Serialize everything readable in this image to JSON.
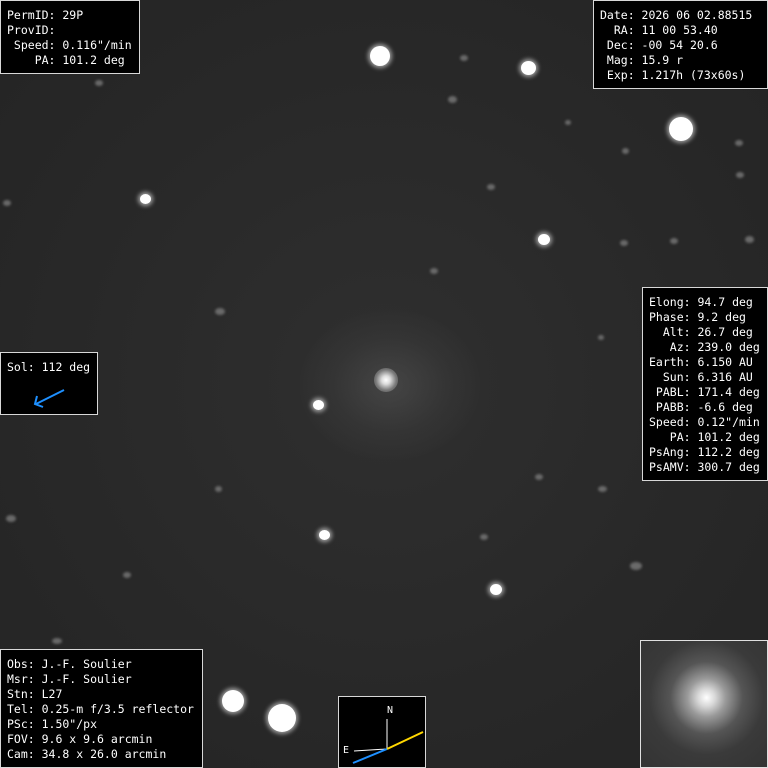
{
  "top_left": {
    "lines": [
      "PermID: 29P",
      "ProvID:",
      " Speed: 0.116\"/min",
      "    PA: 101.2 deg"
    ]
  },
  "top_right": {
    "lines": [
      "Date: 2026 06 02.88515",
      "  RA: 11 00 53.40",
      " Dec: -00 54 20.6",
      " Mag: 15.9 r",
      " Exp: 1.217h (73x60s)"
    ]
  },
  "right_info": {
    "lines": [
      "Elong: 94.7 deg",
      "Phase: 9.2 deg",
      "  Alt: 26.7 deg",
      "   Az: 239.0 deg",
      "Earth: 6.150 AU",
      "  Sun: 6.316 AU",
      " PABL: 171.4 deg",
      " PABB: -6.6 deg",
      "Speed: 0.12\"/min",
      "   PA: 101.2 deg",
      "PsAng: 112.2 deg",
      "PsAMV: 300.7 deg"
    ]
  },
  "sol": {
    "label": "Sol: 112 deg",
    "arrow_color": "#1e90ff"
  },
  "bottom_left": {
    "lines": [
      "Obs: J.-F. Soulier",
      "Msr: J.-F. Soulier",
      "Stn: L27",
      "Tel: 0.25-m f/3.5 reflector",
      "PSc: 1.50\"/px",
      "FOV: 9.6 x 9.6 arcmin",
      "Cam: 34.8 x 26.0 arcmin"
    ]
  },
  "compass": {
    "north": "N",
    "east": "E",
    "sun_color": "#1e90ff",
    "motion_color": "#ffd700"
  }
}
